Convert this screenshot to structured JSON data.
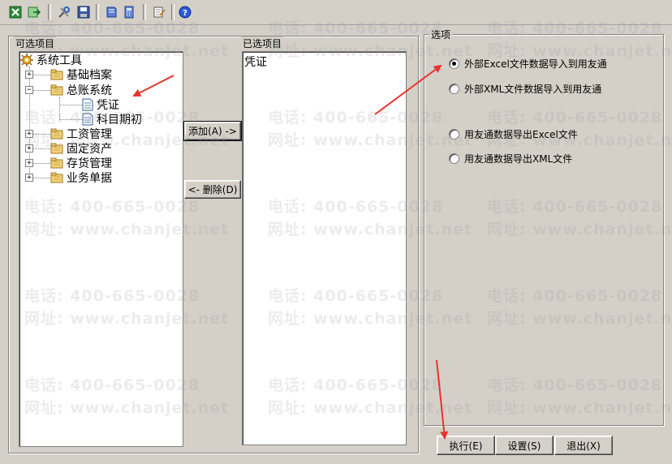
{
  "toolbar": {
    "icons": [
      "excel-icon",
      "export-icon",
      "tools-icon",
      "save-icon",
      "book-icon",
      "calculator-icon",
      "edit-icon",
      "help-icon"
    ]
  },
  "left_panel": {
    "label": "可选项目",
    "tree": {
      "root": "系统工具",
      "items": [
        {
          "label": "基础档案"
        },
        {
          "label": "总账系统",
          "children": [
            {
              "label": "凭证"
            },
            {
              "label": "科目期初"
            }
          ]
        },
        {
          "label": "工资管理"
        },
        {
          "label": "固定资产"
        },
        {
          "label": "存货管理"
        },
        {
          "label": "业务单据"
        }
      ]
    }
  },
  "buttons": {
    "add": "添加(A) ->",
    "remove": "<- 删除(D)",
    "execute": "执行(E)",
    "settings": "设置(S)",
    "exit": "退出(X)"
  },
  "middle_panel": {
    "label": "已选项目",
    "items": [
      "凭证"
    ]
  },
  "options": {
    "label": "选项",
    "radios": [
      {
        "label": "外部Excel文件数据导入到用友通",
        "checked": true
      },
      {
        "label": "外部XML文件数据导入到用友通",
        "checked": false
      },
      {
        "label": "用友通数据导出Excel文件",
        "checked": false
      },
      {
        "label": "用友通数据导出XML文件",
        "checked": false
      }
    ]
  },
  "watermark": {
    "phone": "电话: 400-665-0028",
    "site": "网址: www.chanjet.net"
  },
  "colors": {
    "annotation_arrow": "#e8332b",
    "window_bg": "#d4d0c8"
  }
}
